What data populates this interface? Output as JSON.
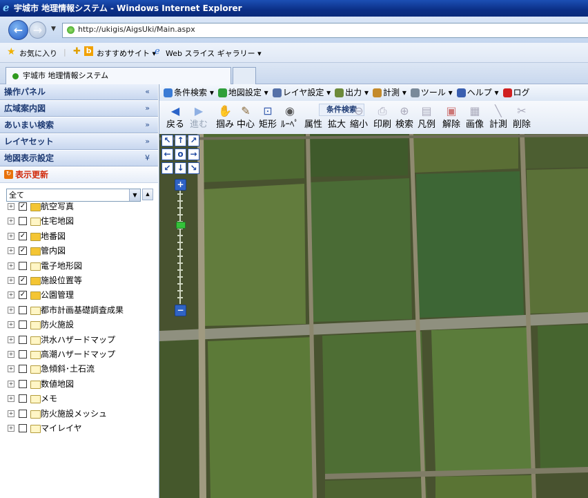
{
  "window": {
    "title": "宇城市 地理情報システム - Windows Internet Explorer"
  },
  "address": {
    "url": "http://ukigis/AigsUki/Main.aspx"
  },
  "favorites": {
    "favorites_label": "お気に入り",
    "suggested_label": "おすすめサイト ▾",
    "webslice_label": "Web スライス ギャラリー ▾"
  },
  "tab": {
    "active_label": "宇城市 地理情報システム"
  },
  "panel": {
    "headers": [
      {
        "label": "操作パネル",
        "chevron": "«"
      },
      {
        "label": "広域案内図",
        "chevron": "»"
      },
      {
        "label": "あいまい検索",
        "chevron": "»"
      },
      {
        "label": "レイヤセット",
        "chevron": "»"
      },
      {
        "label": "地図表示設定",
        "chevron": "¥"
      }
    ],
    "refresh_label": "表示更新",
    "select_value": "全て",
    "layers": [
      {
        "name": "航空写真",
        "checked": true
      },
      {
        "name": "住宅地図",
        "checked": false
      },
      {
        "name": "地番図",
        "checked": true
      },
      {
        "name": "管内図",
        "checked": true
      },
      {
        "name": "電子地形図",
        "checked": false
      },
      {
        "name": "施設位置等",
        "checked": true
      },
      {
        "name": "公園管理",
        "checked": true
      },
      {
        "name": "都市計画基礎調査成果",
        "checked": false
      },
      {
        "name": "防火施設",
        "checked": false
      },
      {
        "name": "洪水ハザードマップ",
        "checked": false
      },
      {
        "name": "高潮ハザードマップ",
        "checked": false
      },
      {
        "name": "急傾斜･土石流",
        "checked": false
      },
      {
        "name": "数値地図",
        "checked": false
      },
      {
        "name": "メモ",
        "checked": false
      },
      {
        "name": "防火施設メッシュ",
        "checked": false
      },
      {
        "name": "マイレイヤ",
        "checked": false
      }
    ]
  },
  "menu": {
    "items": [
      {
        "label": "条件検索 ▾",
        "color": "#3a7bd5"
      },
      {
        "label": "地図設定 ▾",
        "color": "#2e9e3a"
      },
      {
        "label": "レイヤ設定 ▾",
        "color": "#5470a8"
      },
      {
        "label": "出力 ▾",
        "color": "#6c8a3a"
      },
      {
        "label": "計測 ▾",
        "color": "#c48a2a"
      },
      {
        "label": "ツール ▾",
        "color": "#7a8a9a"
      },
      {
        "label": "ヘルプ ▾",
        "color": "#3a5fb0"
      },
      {
        "label": "ログ",
        "color": "#d02020"
      }
    ]
  },
  "toolbar": {
    "search_label": "条件検索",
    "tools": [
      {
        "label": "戻る",
        "icon": "◀",
        "enabled": true
      },
      {
        "label": "進む",
        "icon": "▶",
        "enabled": false
      },
      {
        "label": "掴み",
        "icon": "✋",
        "enabled": true
      },
      {
        "label": "中心",
        "icon": "✎",
        "enabled": true
      },
      {
        "label": "矩形",
        "icon": "⊡",
        "enabled": true
      },
      {
        "label": "ﾙｰﾍﾟ",
        "icon": "◉",
        "enabled": true
      },
      {
        "label": "属性",
        "icon": "",
        "enabled": true
      },
      {
        "label": "拡大",
        "icon": "",
        "enabled": true
      },
      {
        "label": "縮小",
        "icon": "⊖",
        "enabled": true
      },
      {
        "label": "印刷",
        "icon": "⎙",
        "enabled": true
      },
      {
        "label": "検索",
        "icon": "⊕",
        "enabled": true
      },
      {
        "label": "凡例",
        "icon": "▤",
        "enabled": true
      },
      {
        "label": "解除",
        "icon": "▣",
        "enabled": true
      },
      {
        "label": "画像",
        "icon": "▦",
        "enabled": true
      },
      {
        "label": "計測",
        "icon": "╲",
        "enabled": true
      },
      {
        "label": "削除",
        "icon": "✂",
        "enabled": true
      }
    ]
  },
  "navpad": {
    "buttons": [
      "↖",
      "↑",
      "↗",
      "←",
      "o",
      "→",
      "↙",
      "↓",
      "↘"
    ],
    "zoom_in": "+",
    "zoom_out": "−",
    "zoom_level": 0.3
  },
  "icons": {
    "ie": "ie-logo-icon",
    "back": "back-arrow-icon",
    "forward": "forward-arrow-icon"
  }
}
